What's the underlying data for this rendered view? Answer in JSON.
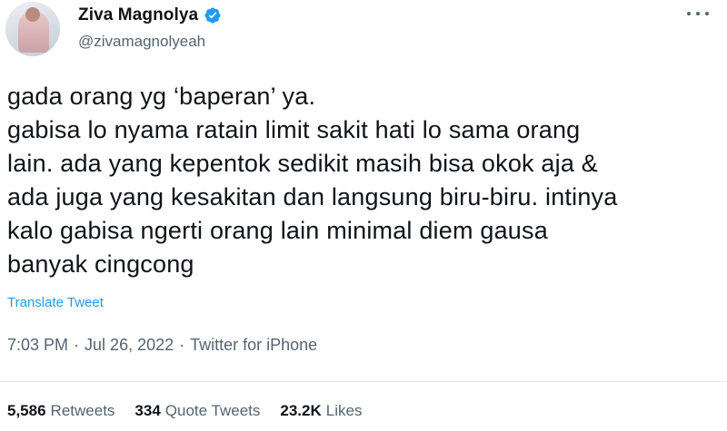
{
  "author": {
    "display_name": "Ziva Magnolya",
    "handle": "@zivamagnolyeah",
    "verified": true
  },
  "tweet": {
    "lines": [
      "gada orang yg ‘baperan’ ya.",
      "gabisa lo nyama ratain limit sakit hati lo sama orang",
      "lain. ada yang kepentok sedikit masih bisa okok aja &",
      "ada juga yang kesakitan dan langsung biru-biru. intinya",
      "kalo gabisa ngerti orang lain minimal diem gausa",
      "banyak cingcong"
    ],
    "translate_label": "Translate Tweet"
  },
  "meta": {
    "time": "7:03 PM",
    "separator": "·",
    "date": "Jul 26, 2022",
    "source": "Twitter for iPhone"
  },
  "stats": {
    "retweets_count": "5,586",
    "retweets_label": "Retweets",
    "quote_count": "334",
    "quote_label": "Quote Tweets",
    "likes_count": "23.2K",
    "likes_label": "Likes"
  },
  "colors": {
    "verified": "#1d9bf0",
    "link": "#1d9bf0",
    "secondary_text": "#536471",
    "primary_text": "#0f1419"
  },
  "icons": {
    "verified": "verified-badge-icon",
    "more": "more-options-icon"
  }
}
